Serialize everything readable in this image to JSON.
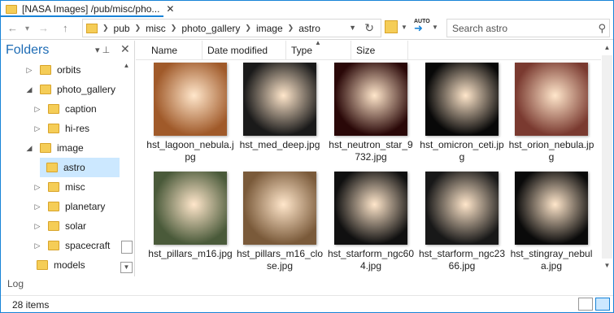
{
  "window": {
    "title": "[NASA Images] /pub/misc/pho...",
    "close": "✕"
  },
  "address": {
    "crumbs": [
      "pub",
      "misc",
      "photo_gallery",
      "image",
      "astro"
    ],
    "search_placeholder": "Search astro",
    "auto_label": "AUTO"
  },
  "folders": {
    "title": "Folders",
    "items": [
      {
        "label": "orbits",
        "arrow": "▷"
      },
      {
        "label": "photo_gallery",
        "arrow": "◢"
      },
      {
        "label": "caption",
        "arrow": "▷"
      },
      {
        "label": "hi-res",
        "arrow": "▷"
      },
      {
        "label": "image",
        "arrow": "◢"
      },
      {
        "label": "astro",
        "arrow": ""
      },
      {
        "label": "misc",
        "arrow": "▷"
      },
      {
        "label": "planetary",
        "arrow": "▷"
      },
      {
        "label": "solar",
        "arrow": "▷"
      },
      {
        "label": "spacecraft",
        "arrow": "▷"
      },
      {
        "label": "models",
        "arrow": ""
      }
    ]
  },
  "columns": [
    "Name",
    "Date modified",
    "Type",
    "Size"
  ],
  "files": [
    {
      "name": "hst_lagoon_nebula.jpg",
      "color": "#a05a2a"
    },
    {
      "name": "hst_med_deep.jpg",
      "color": "#1a1a1a"
    },
    {
      "name": "hst_neutron_star_9732.jpg",
      "color": "#2a0808"
    },
    {
      "name": "hst_omicron_ceti.jpg",
      "color": "#080808"
    },
    {
      "name": "hst_orion_nebula.jpg",
      "color": "#7a3a30"
    },
    {
      "name": "hst_pillars_m16.jpg",
      "color": "#4a5a3a"
    },
    {
      "name": "hst_pillars_m16_close.jpg",
      "color": "#7a5a3a"
    },
    {
      "name": "hst_starform_ngc604.jpg",
      "color": "#101010"
    },
    {
      "name": "hst_starform_ngc2366.jpg",
      "color": "#181818"
    },
    {
      "name": "hst_stingray_nebula.jpg",
      "color": "#0a0a0a"
    }
  ],
  "log_label": "Log",
  "status": {
    "count": "28 items"
  }
}
